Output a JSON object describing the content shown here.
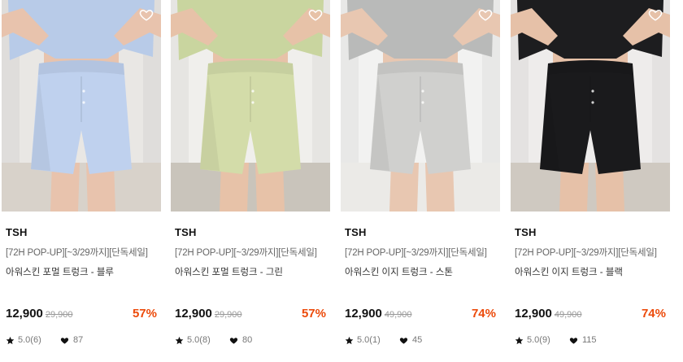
{
  "products": [
    {
      "brand": "TSH",
      "promo": "[72H POP-UP][~3/29까지][단독세일]",
      "name": "아워스킨 포멀 트렁크 - 블루",
      "price": "12,900",
      "original_price": "29,900",
      "discount": "57%",
      "rating": "5.0(6)",
      "likes": "87",
      "colors": {
        "bg": "#e9e7e4",
        "shirt": "#b8cbe8",
        "shorts": "#bfd1ee",
        "skin": "#e8c3ad",
        "floor": "#d8d2ca"
      }
    },
    {
      "brand": "TSH",
      "promo": "[72H POP-UP][~3/29까지][단독세일]",
      "name": "아워스킨 포멀 트렁크 - 그린",
      "price": "12,900",
      "original_price": "29,900",
      "discount": "57%",
      "rating": "5.0(8)",
      "likes": "80",
      "colors": {
        "bg": "#f0efec",
        "shirt": "#c9d59f",
        "shorts": "#d3dca9",
        "skin": "#e7c2a8",
        "floor": "#c9c4bb"
      }
    },
    {
      "brand": "TSH",
      "promo": "[72H POP-UP][~3/29까지][단독세일]",
      "name": "아워스킨 이지 트렁크 - 스톤",
      "price": "12,900",
      "original_price": "49,900",
      "discount": "74%",
      "rating": "5.0(1)",
      "likes": "45",
      "colors": {
        "bg": "#f2f2f1",
        "shirt": "#b9bab9",
        "shorts": "#d0d0ce",
        "skin": "#e8c7b1",
        "floor": "#ebeae7"
      }
    },
    {
      "brand": "TSH",
      "promo": "[72H POP-UP][~3/29까지][단독세일]",
      "name": "아워스킨 이지 트렁크 - 블랙",
      "price": "12,900",
      "original_price": "49,900",
      "discount": "74%",
      "rating": "5.0(9)",
      "likes": "115",
      "colors": {
        "bg": "#eeeceb",
        "shirt": "#1d1d1f",
        "shorts": "#1a1a1c",
        "skin": "#e6c1a8",
        "floor": "#cfc9c1"
      }
    }
  ],
  "icons": {
    "wishlist": "heart-outline-icon",
    "rating": "star-icon",
    "likes": "heart-filled-icon"
  }
}
